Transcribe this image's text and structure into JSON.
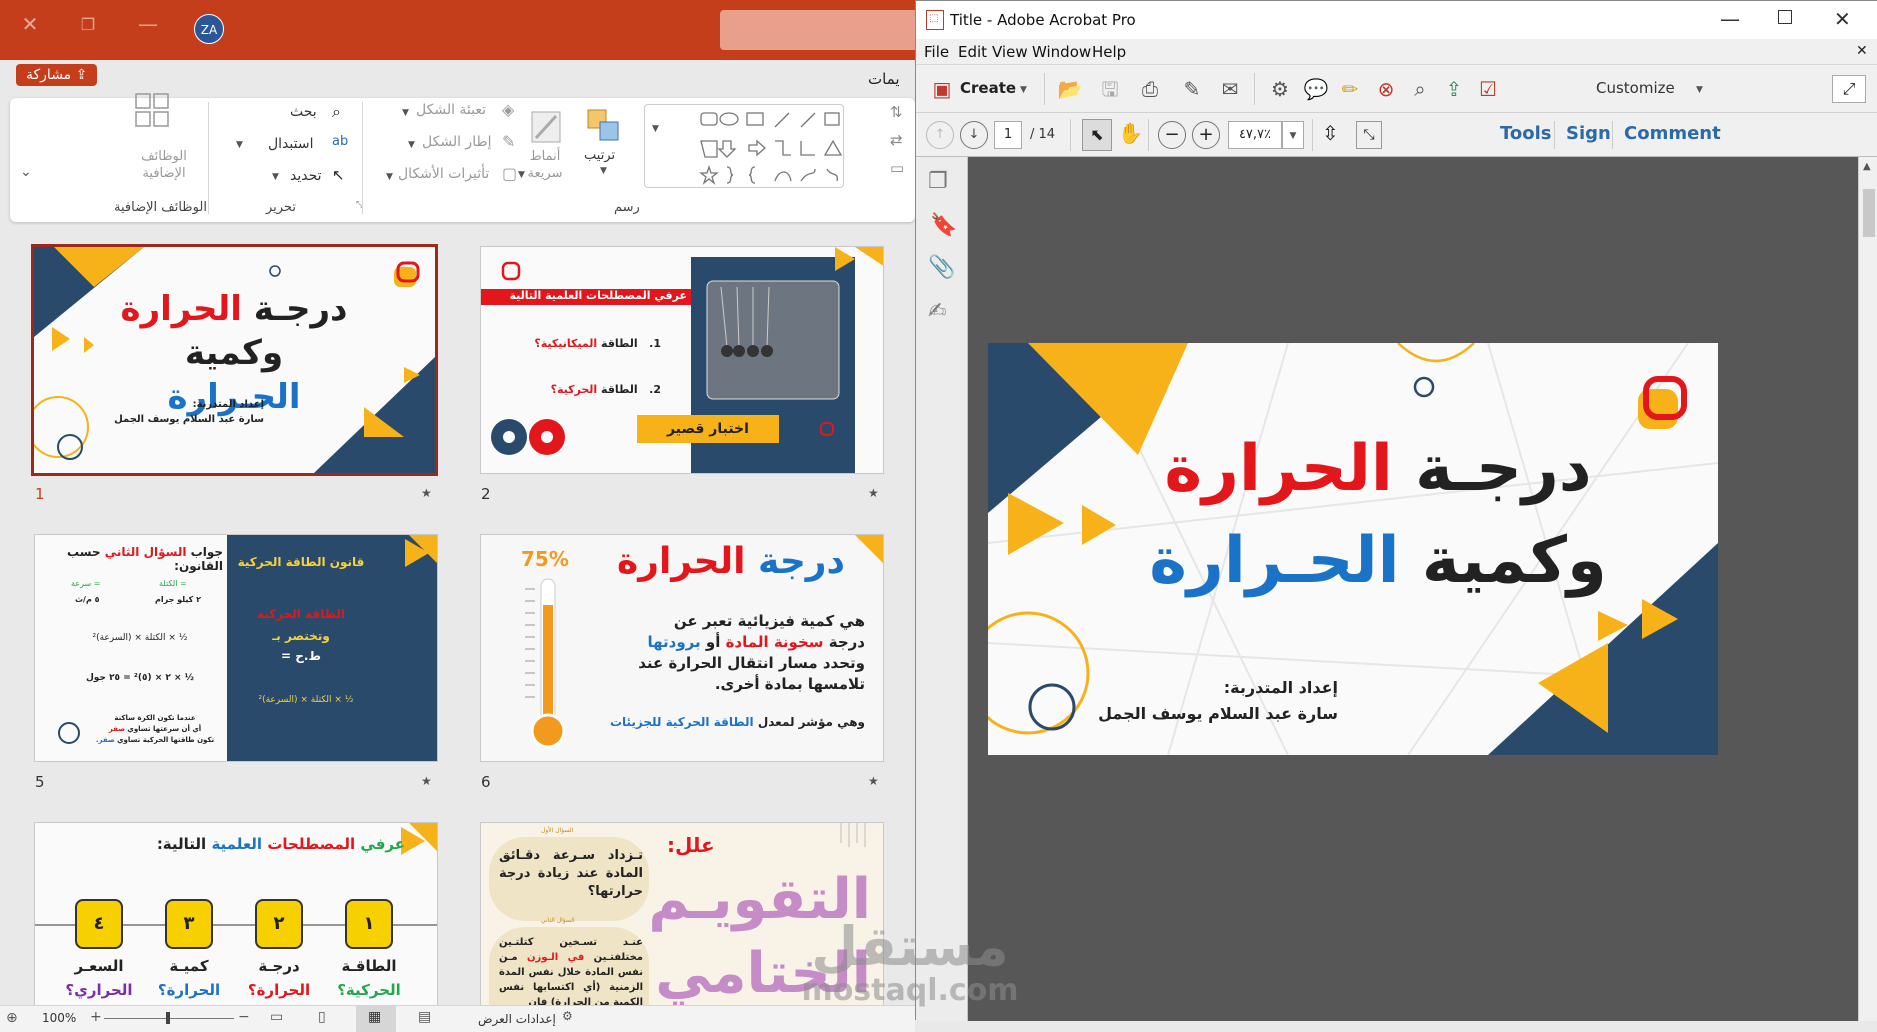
{
  "powerpoint": {
    "titlebar": {
      "avatar_initials": "ZA",
      "close_glyph": "✕",
      "restore_glyph": "❐",
      "minimize_glyph": "—"
    },
    "share_label": "مشاركة",
    "ribbon_tab_label": "يمات",
    "groups": {
      "addins": {
        "label": "الوظائف الإضافية",
        "button": "الوظائف الإضافية"
      },
      "editing": {
        "label": "تحرير",
        "find": "بحث",
        "replace": "استبدال",
        "select": "تحديد"
      },
      "drawing": {
        "label": "رسم",
        "arrange": "ترتيب",
        "quick_styles": "أنماط سريعة",
        "shape_fill": "تعبئة الشكل",
        "shape_outline": "إطار الشكل",
        "shape_effects": "تأثيرات الأشكال"
      }
    },
    "slides": [
      {
        "number": "1",
        "title_line1_a": "درجـة",
        "title_line1_b": "الحرارة",
        "title_line2_a": "وكمية",
        "title_line2_b": "الحـرارة",
        "author_label": "إعداد المتدربة:",
        "author_name": "سارة عبد السلام يوسف الجمل"
      },
      {
        "number": "2",
        "header": "عرفي المصطلحات العلمية التالية",
        "item1_a": "الطاقة",
        "item1_b": "الميكانيكية؟",
        "item1_num": "1.",
        "item2_a": "الطاقة",
        "item2_b": "الحركية؟",
        "item2_num": "2.",
        "quiz_label": "اختبار قصير"
      },
      {
        "number": "5",
        "q_title_a": "جواب",
        "q_title_b": "السؤال الثاني",
        "q_title_c": "حسب القانون:",
        "speed_label": "سرعة =",
        "mass_label": "الكتلة =",
        "speed_val": "٥ م/ث",
        "mass_val": "٢ كيلو جرام",
        "formula1": "½ × الكتلة × (السرعة)²",
        "formula2": "½ × ٢ × (٥)² = ٢٥ جول",
        "note1": "عندما تكون الكرة ساكنة",
        "note2_a": "أي أن سرعتها تساوي",
        "note2_b": "صفر",
        "note3_a": "تكون طاقتها الحركية تساوي",
        "note3_b": "صفر.",
        "law_title": "قانون الطاقة الحركية",
        "law_term": "الطاقة الحركية",
        "law_short": "وتختصر بـ",
        "law_symbol": "ط.ح =",
        "law_formula": "½ × الكتلة × (السرعة)²"
      },
      {
        "number": "6",
        "title_a": "درجة",
        "title_b": "الحرارة",
        "percent": "75%",
        "p1": "هي كمية فيزيائية تعبر عن",
        "p2_a": "درجة",
        "p2_b": "سخونة المادة",
        "p2_c": "أو",
        "p2_d": "برودتها",
        "p3": "وتحدد مسار انتقال الحرارة عند",
        "p4": "تلامسها بمادة أخرى.",
        "p5_a": "وهي مؤشر لمعدل",
        "p5_b": "الطاقة الحركية للجزيئات"
      },
      {
        "number": "",
        "header_a": "عرفي",
        "header_b": "المصطلحات",
        "header_c": "العلمية",
        "header_d": "التالية:",
        "boxes": [
          "٤",
          "٣",
          "٢",
          "١"
        ],
        "terms_top": [
          "السعـر",
          "كميـة",
          "درجـة",
          "الطاقـة"
        ],
        "terms_bottom": [
          "الحراري؟",
          "الحرارة؟",
          "الحرارة؟",
          "الحركية؟"
        ]
      },
      {
        "number": "",
        "why": "علل:",
        "q1_label": "السؤال الأول",
        "q1": "تـزداد سـرعة دقـائق المادة عند زيادة درجة حرارتها؟",
        "q2_label": "السؤال الثاني",
        "q2_a": "عنـد تسـخين كتلتـين مختلفتـين",
        "q2_b": "في الـوزن",
        "q2_c": "مـن نفس المادة خلال نفس المدة الزمنية (أي اكتسابها نفس الكمية من الحرارة) فإن",
        "big_title": "التقويـم الختامي"
      }
    ],
    "status": {
      "zoom": "100%",
      "view_settings": "إعدادات العرض"
    }
  },
  "acrobat": {
    "title": "Title - Adobe Acrobat Pro",
    "menu": [
      "File",
      "Edit",
      "View",
      "Window",
      "Help"
    ],
    "create_label": "Create",
    "customize_label": "Customize",
    "page_current": "1",
    "page_total": "/ 14",
    "zoom": "٤٧,٧٪",
    "tools": "Tools",
    "sign": "Sign",
    "comment": "Comment",
    "slide": {
      "line1_a": "درجـة",
      "line1_b": "الحرارة",
      "line2_a": "وكمية",
      "line2_b": "الحـرارة",
      "author_label": "إعداد المتدربة:",
      "author_name": "سارة عبد السلام يوسف الجمل"
    }
  },
  "watermark": {
    "arabic": "مستقل",
    "latin": "mostaql.com"
  },
  "colors": {
    "powerpoint_accent": "#c43e1c",
    "red": "#e3161b",
    "blue": "#1a73c7",
    "yellow": "#f7b21a",
    "navy": "#2a4a6b"
  }
}
